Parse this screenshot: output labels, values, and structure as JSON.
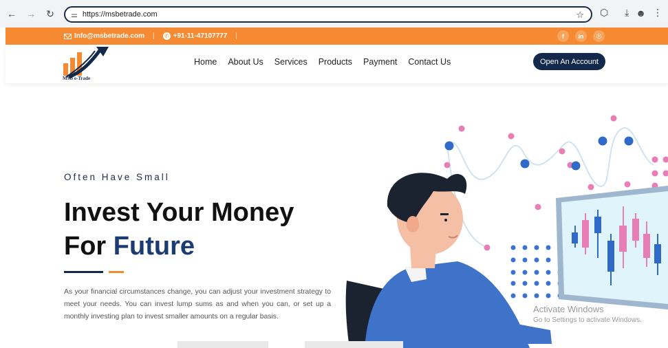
{
  "browser": {
    "url": "https://msbetrade.com",
    "back_icon": "arrow-left-icon",
    "forward_icon": "arrow-right-icon",
    "reload_icon": "reload-icon"
  },
  "topbar": {
    "email": "Info@msbetrade.com",
    "phone": "+91-11-47107777",
    "socials": [
      "f",
      "in",
      "◎"
    ]
  },
  "brand": {
    "logo_text": "MSB e-Trade"
  },
  "nav": {
    "items": [
      "Home",
      "About Us",
      "Services",
      "Products",
      "Payment",
      "Contact Us"
    ],
    "cta": "Open An Account"
  },
  "hero": {
    "kicker": "Often Have Small",
    "title_line1": "Invest Your Money",
    "title_prefix": "For ",
    "title_accent": "Future",
    "description": "As your financial circumstances change, you can adjust your investment strategy to meet your needs. You can invest lump sums as and when you can, or set up a monthly investing plan to invest smaller amounts on a regular basis."
  },
  "watermark": {
    "line1": "Activate Windows",
    "line2": "Go to Settings to activate Windows."
  },
  "colors": {
    "orange": "#f58a32",
    "navy": "#13294b",
    "accent_blue": "#1b3b73"
  }
}
